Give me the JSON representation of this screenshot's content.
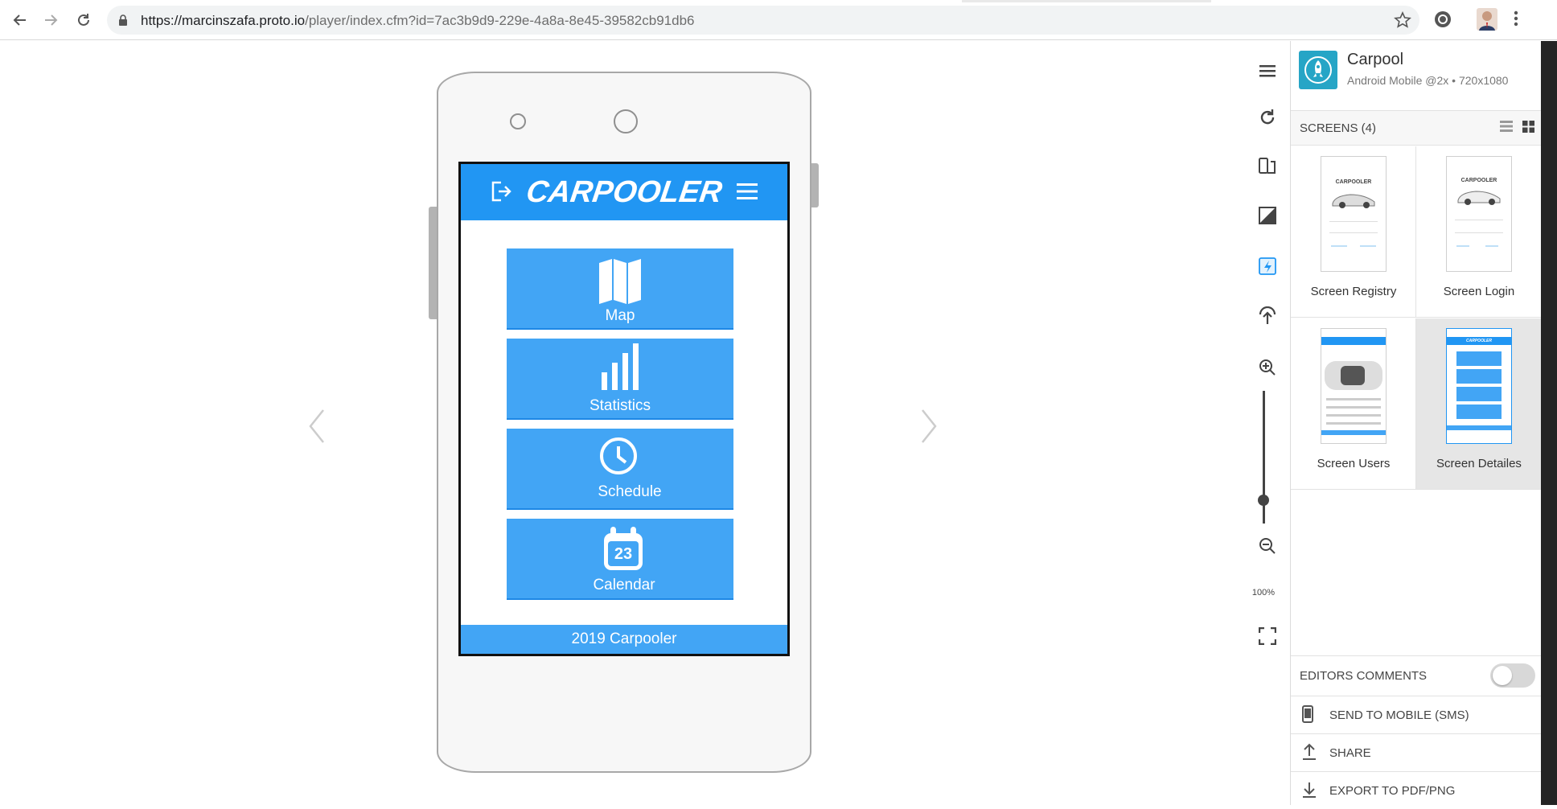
{
  "browser": {
    "url_domain": "https://marcinszafa.proto.io",
    "url_path": "/player/index.cfm?id=7ac3b9d9-229e-4a8a-8e45-39582cb91db6"
  },
  "app": {
    "logo_text": "CARPOOLER",
    "tiles": [
      {
        "label": "Map",
        "icon": "map-icon"
      },
      {
        "label": "Statistics",
        "icon": "bar-chart-icon"
      },
      {
        "label": "Schedule",
        "icon": "clock-icon"
      },
      {
        "label": "Calendar",
        "icon": "calendar-icon",
        "day": "23"
      }
    ],
    "footer": "2019 Carpooler",
    "colors": {
      "header": "#2196f3",
      "tile": "#42a5f5"
    }
  },
  "toolbar": {
    "zoom_level": "100%"
  },
  "panel": {
    "project_name": "Carpool",
    "project_sub": "Android Mobile @2x • 720x1080",
    "screens_header": "SCREENS (4)",
    "screens": [
      {
        "name": "Screen Registry"
      },
      {
        "name": "Screen Login"
      },
      {
        "name": "Screen Users"
      },
      {
        "name": "Screen Detailes"
      }
    ],
    "editors_comments": "EDITORS COMMENTS",
    "actions": {
      "sms": "SEND TO MOBILE (SMS)",
      "share": "SHARE",
      "export": "EXPORT TO PDF/PNG"
    },
    "accent": "#26a5c6"
  }
}
